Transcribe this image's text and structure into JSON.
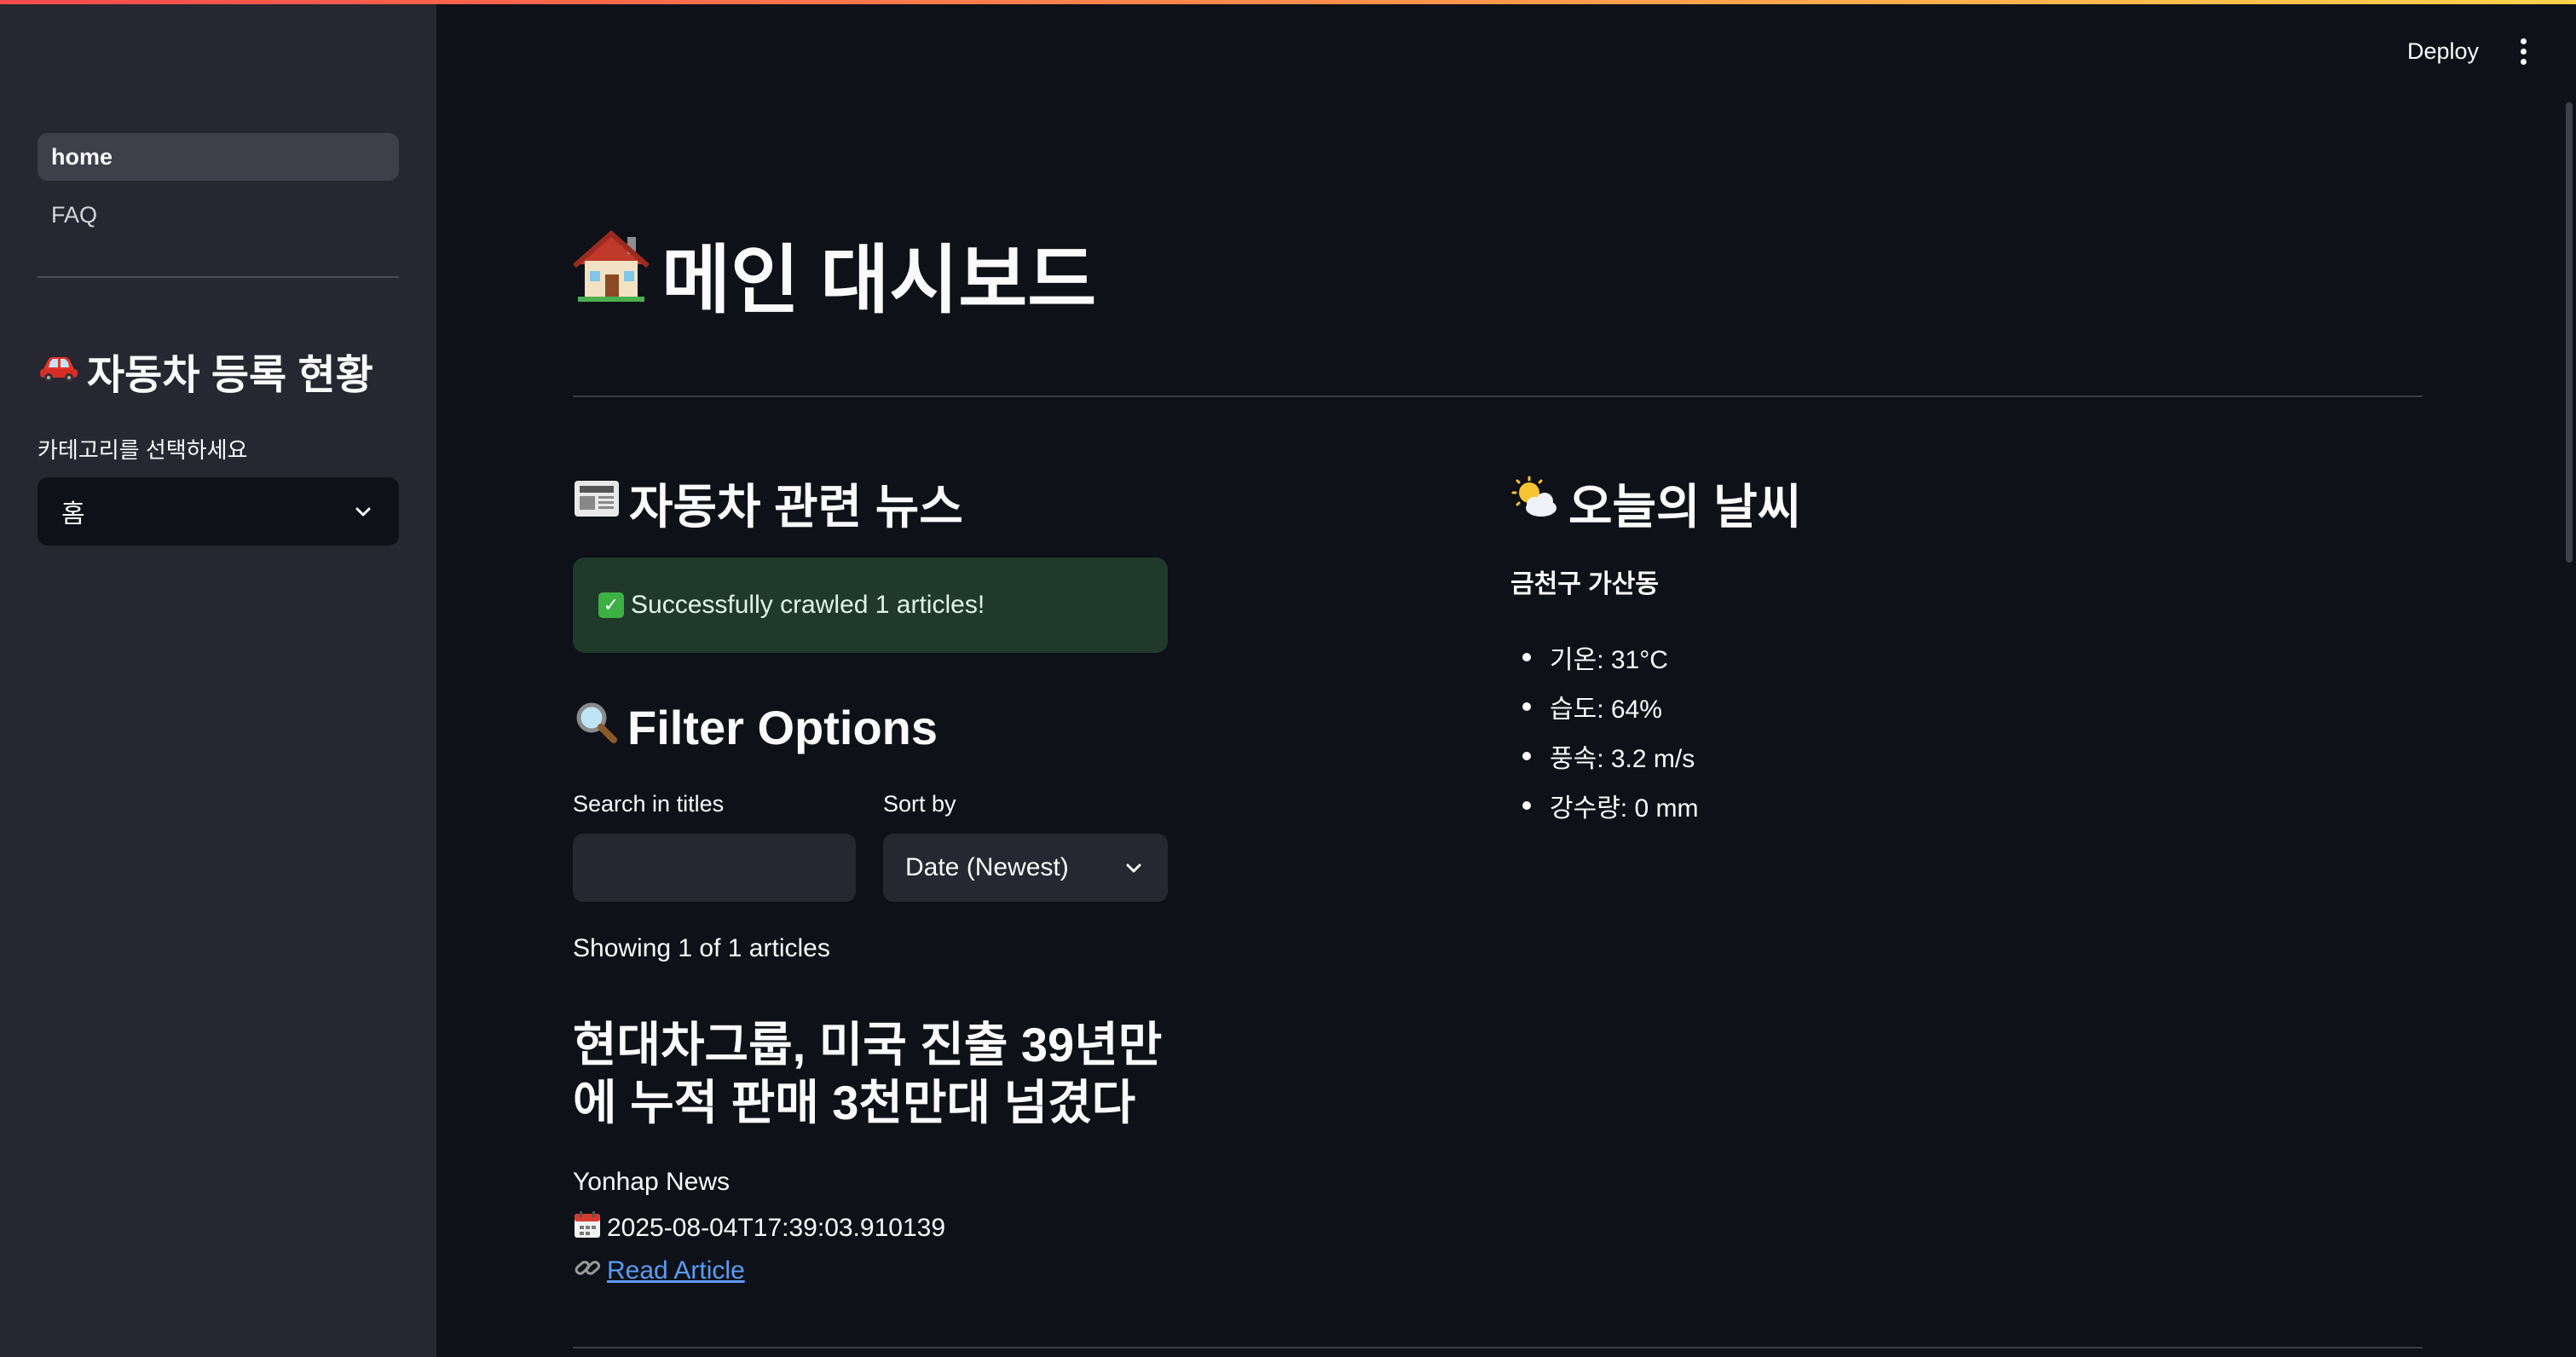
{
  "sidebar": {
    "nav": [
      {
        "label": "home",
        "active": true
      },
      {
        "label": "FAQ",
        "active": false
      }
    ],
    "section_title": "자동차 등록 현황",
    "section_icon": "car-icon",
    "select_label": "카테고리를 선택하세요",
    "select_value": "홈"
  },
  "header": {
    "deploy_label": "Deploy",
    "menu_icon": "kebab-menu-icon"
  },
  "main": {
    "title": "메인 대시보드",
    "title_icon": "house-icon",
    "news": {
      "title": "자동차 관련 뉴스",
      "title_icon": "newspaper-icon",
      "success_message": "Successfully crawled 1 articles!",
      "filter_title": "Filter Options",
      "filter_icon": "magnifier-icon",
      "search_label": "Search in titles",
      "search_value": "",
      "sort_label": "Sort by",
      "sort_value": "Date (Newest)",
      "showing_text": "Showing 1 of 1 articles",
      "article": {
        "title": "현대차그룹, 미국 진출 39년만에 누적 판매 3천만대 넘겼다",
        "source": "Yonhap News",
        "date": "2025-08-04T17:39:03.910139",
        "link_label": "Read Article"
      }
    },
    "weather": {
      "title": "오늘의 날씨",
      "title_icon": "sun-cloud-icon",
      "location": "금천구 가산동",
      "items": [
        "기온: 31°C",
        "습도: 64%",
        "풍속: 3.2 m/s",
        "강수량: 0 mm"
      ]
    }
  },
  "colors": {
    "background": "#0e1117",
    "sidebar": "#262730",
    "success_bg": "#1f3a2b",
    "link": "#5a9cf8"
  }
}
